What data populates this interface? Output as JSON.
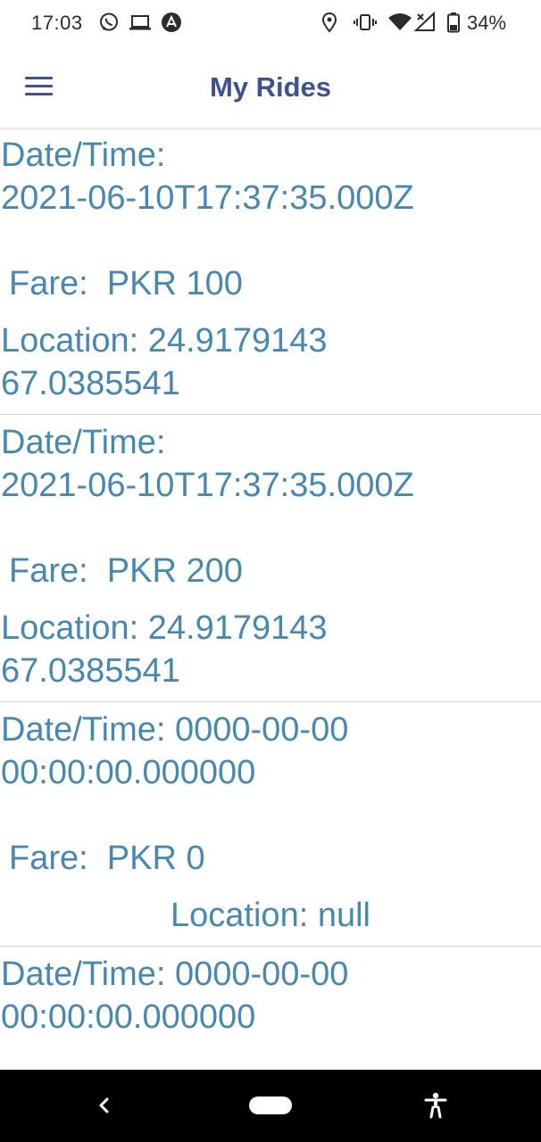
{
  "status_bar": {
    "time": "17:03",
    "battery_percent": "34%",
    "icons": [
      "whatsapp-icon",
      "laptop-icon",
      "app-notification-icon",
      "location-icon",
      "vibrate-icon",
      "wifi-icon",
      "signal-icon",
      "battery-icon"
    ]
  },
  "app_bar": {
    "title": "My Rides",
    "menu_icon": "hamburger-menu-icon"
  },
  "rides": [
    {
      "datetime": "Date/Time:\n2021-06-10T17:37:35.000Z",
      "fare": "Fare:  PKR 100",
      "location": "Location: 24.9179143 67.0385541"
    },
    {
      "datetime": "Date/Time:\n2021-06-10T17:37:35.000Z",
      "fare": "Fare:  PKR 200",
      "location": "Location: 24.9179143 67.0385541"
    },
    {
      "datetime": "Date/Time:  0000-00-00\n00:00:00.000000",
      "fare": "Fare:  PKR 0",
      "location": "Location: null"
    },
    {
      "datetime": "Date/Time:  0000-00-00\n00:00:00.000000",
      "fare": "",
      "location": ""
    }
  ],
  "nav_bar": {
    "icons": [
      "back-icon",
      "home-pill-icon",
      "accessibility-icon"
    ]
  },
  "colors": {
    "title": "#3c5390",
    "ride_text": "#4888b0",
    "divider": "#d6d6d6"
  }
}
